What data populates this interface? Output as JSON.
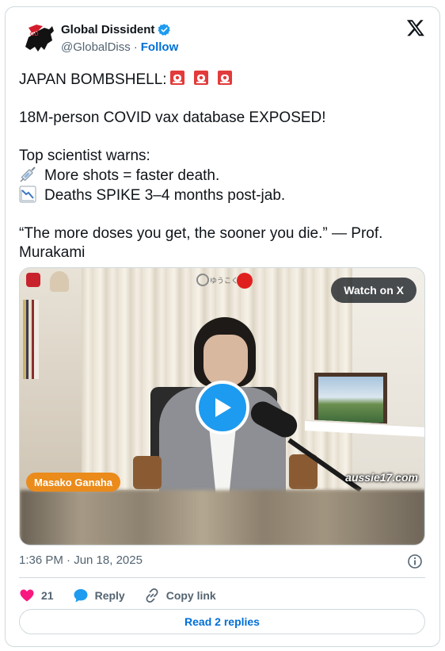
{
  "author": {
    "display_name": "Global Dissident",
    "handle": "@GlobalDiss",
    "separator": "·",
    "follow_label": "Follow",
    "verified_color": "#1d9bf0",
    "avatar_icon": "horse-logo-icon"
  },
  "tweet": {
    "headline": "JAPAN BOMBSHELL:",
    "headline_icons": [
      "siren-icon",
      "siren-icon",
      "siren-icon"
    ],
    "line_2": "18M-person COVID vax database EXPOSED!",
    "line_3": "Top scientist warns:",
    "bullet_1": {
      "icon": "syringe-icon",
      "text": "More shots = faster death."
    },
    "bullet_2": {
      "icon": "chart-decreasing-icon",
      "text": "Deaths SPIKE 3–4 months post-jab."
    },
    "quote": "“The more doses you get, the sooner you die.” — Prof. Murakami"
  },
  "video": {
    "watch_label": "Watch on X",
    "speaker_tag": "Masako Ganaha",
    "watermark": "aussie17.com",
    "top_logo": "ゆうこく",
    "play_icon": "play-icon"
  },
  "meta": {
    "timestamp": "1:36 PM · Jun 18, 2025"
  },
  "actions": {
    "likes": "21",
    "reply_label": "Reply",
    "copy_label": "Copy link",
    "like_color": "#f91880",
    "reply_color": "#1d9bf0"
  },
  "footer": {
    "read_replies_label": "Read 2 replies"
  }
}
